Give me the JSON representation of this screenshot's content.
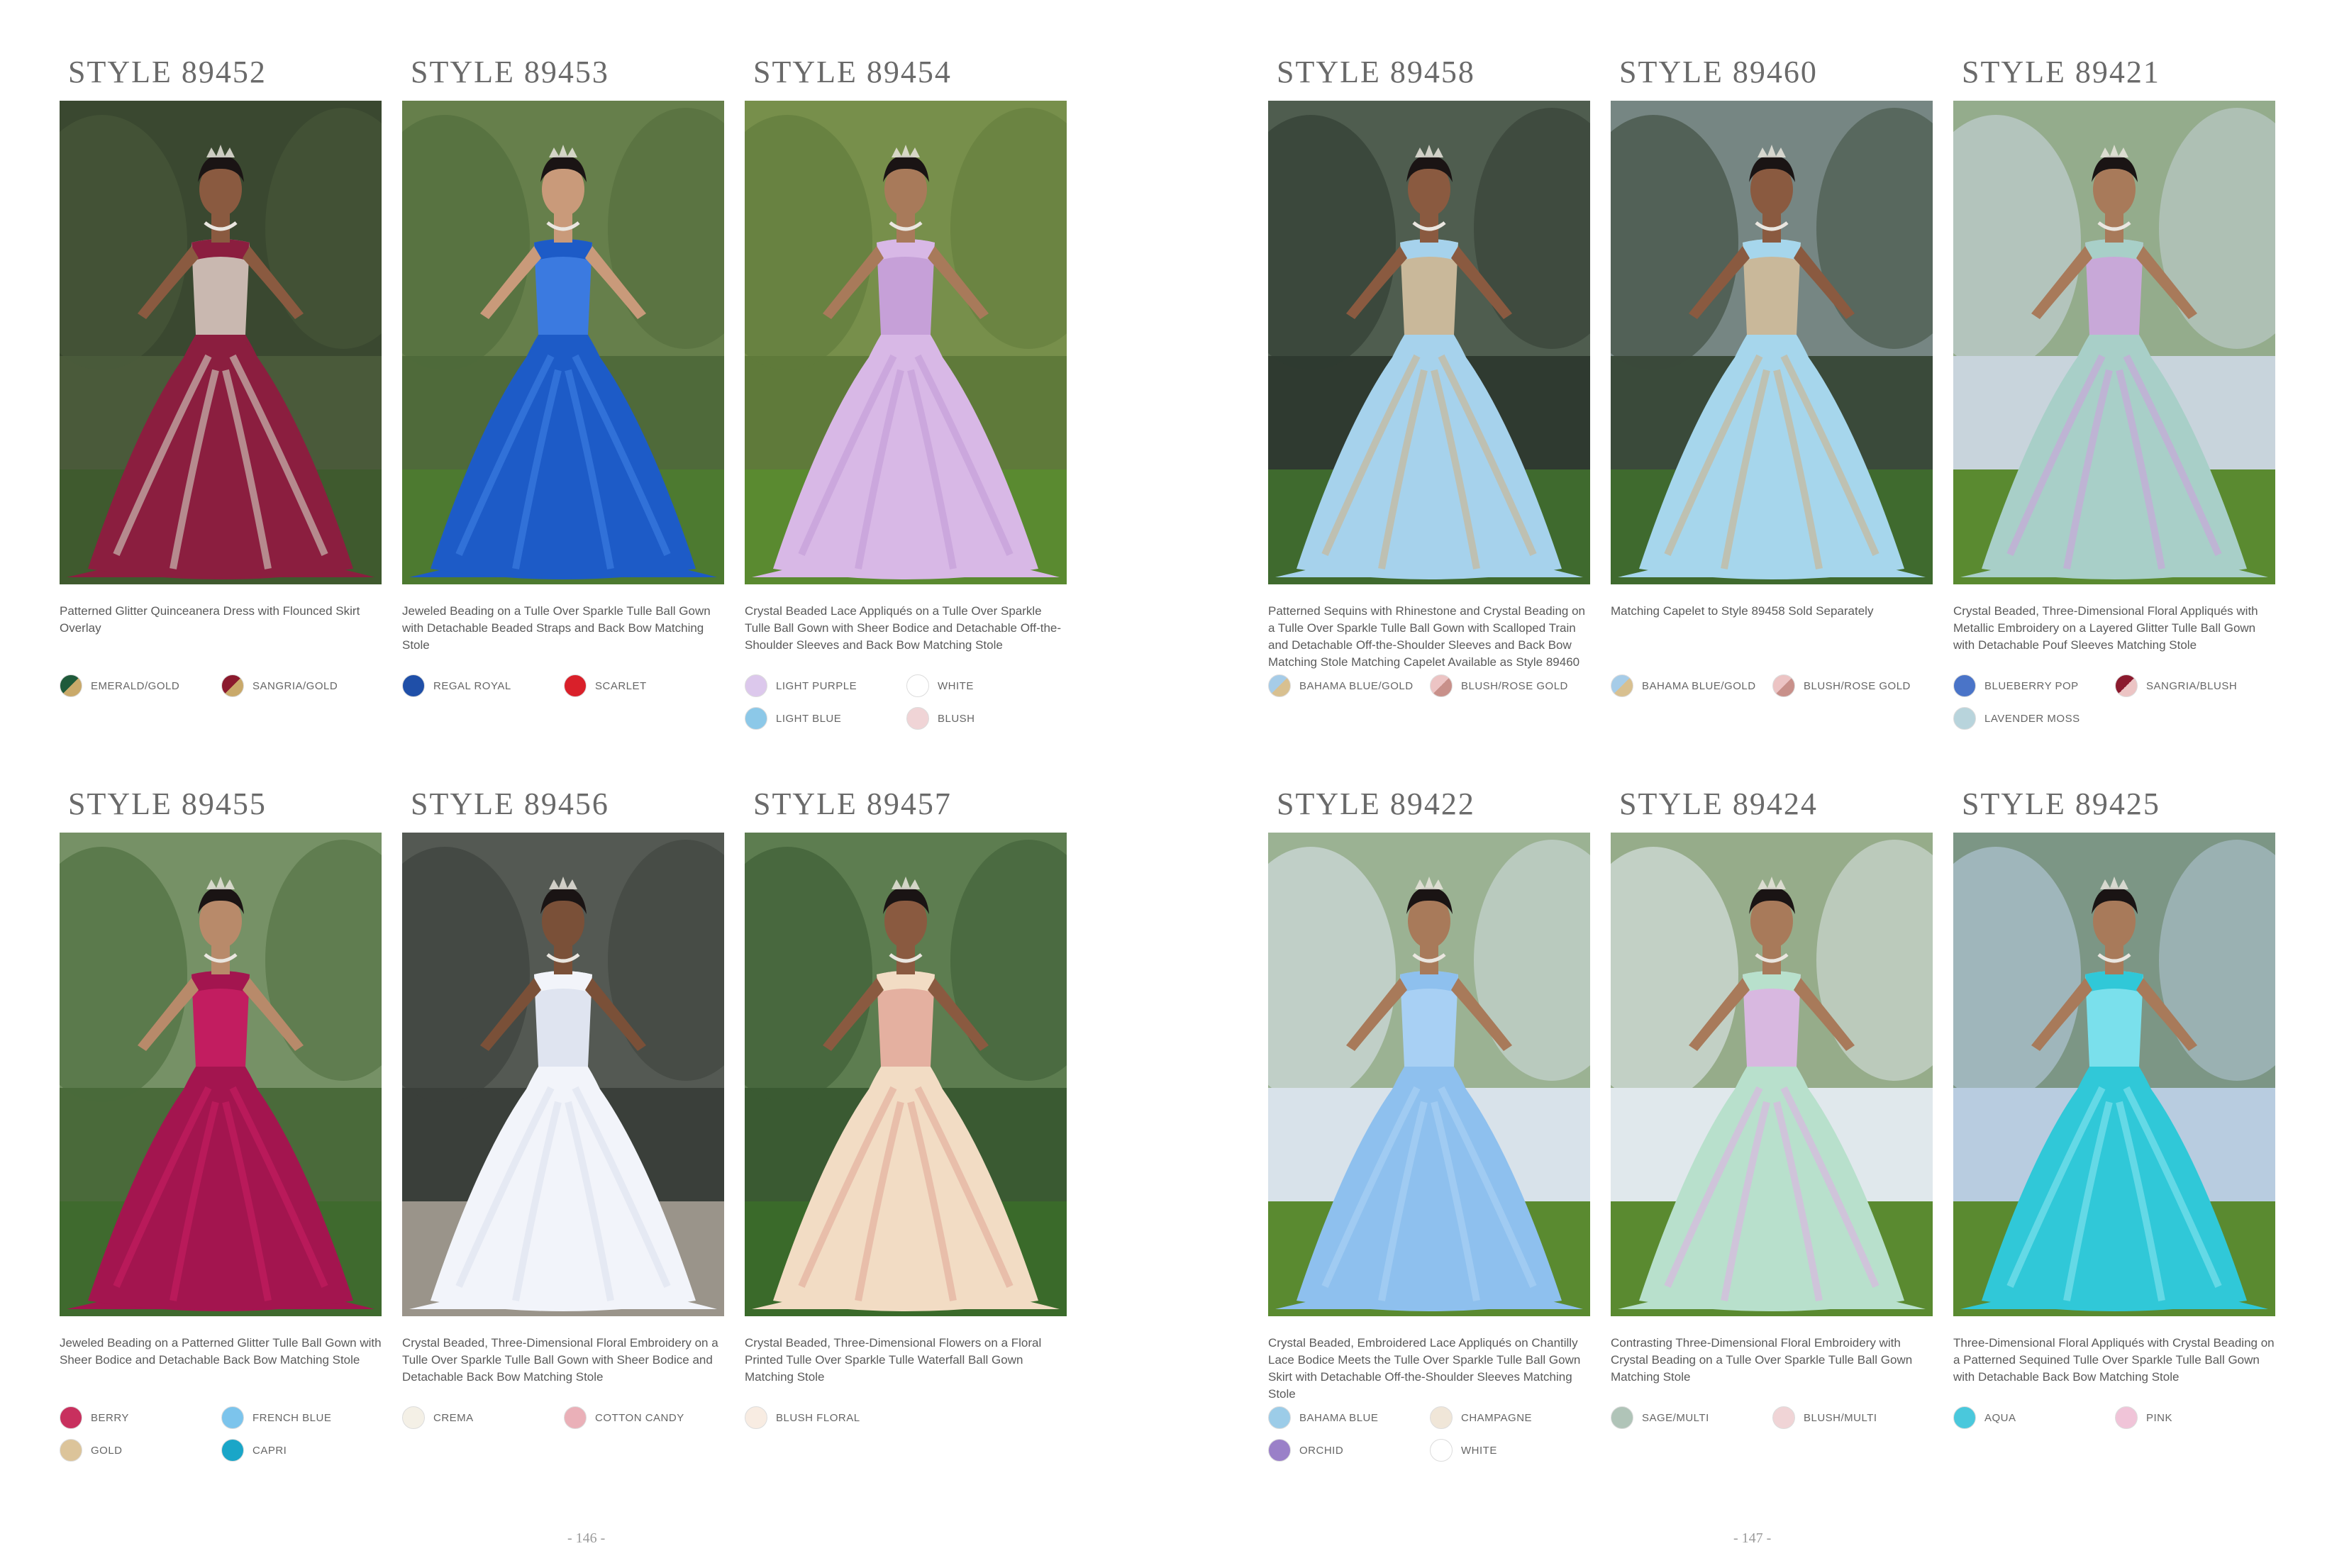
{
  "pages": [
    {
      "page_number": "- 146 -",
      "styles": [
        {
          "title": "STYLE 89452",
          "desc": "Patterned Glitter Quinceanera Dress with Flounced Skirt Overlay",
          "scene": {
            "bg": "#4a5a3a",
            "bg2": "#2e3a28",
            "ground": "#3f5a2e",
            "gown": "#8b1e3f",
            "gown2": "#c9b8b0",
            "skin": "#8a5a40",
            "hair": "#1a1414"
          },
          "colors": [
            {
              "name": "EMERALD/GOLD",
              "a": "#1f5a3a",
              "b": "#c9a96a"
            },
            {
              "name": "SANGRIA/GOLD",
              "a": "#8b1a2e",
              "b": "#c9a96a"
            }
          ]
        },
        {
          "title": "STYLE 89453",
          "desc": "Jeweled Beading on a Tulle Over Sparkle Tulle Ball Gown with Detachable Beaded Straps and Back Bow Matching Stole",
          "scene": {
            "bg": "#4f6a3a",
            "bg2": "#7a8f5a",
            "ground": "#4d7a30",
            "gown": "#1d5bc7",
            "gown2": "#3b7ae0",
            "skin": "#c99a7a",
            "hair": "#1a1414"
          },
          "colors": [
            {
              "name": "REGAL ROYAL",
              "a": "#1f4fa8",
              "b": "#1f4fa8"
            },
            {
              "name": "SCARLET",
              "a": "#d9202a",
              "b": "#d9202a"
            }
          ]
        },
        {
          "title": "STYLE 89454",
          "desc": "Crystal Beaded Lace Appliqués on a Tulle Over Sparkle Tulle Ball Gown with Sheer Bodice and Detachable Off-the-Shoulder Sleeves and Back Bow Matching Stole",
          "scene": {
            "bg": "#5f7a3a",
            "bg2": "#8aa05a",
            "ground": "#5a8a30",
            "gown": "#d8b8e6",
            "gown2": "#c6a0d8",
            "skin": "#a87a5a",
            "hair": "#1a1414"
          },
          "colors": [
            {
              "name": "LIGHT PURPLE",
              "a": "#dcc8ec",
              "b": "#dcc8ec"
            },
            {
              "name": "WHITE",
              "a": "#ffffff",
              "b": "#ffffff"
            },
            {
              "name": "LIGHT BLUE",
              "a": "#8cc8e8",
              "b": "#8cc8e8"
            },
            {
              "name": "BLUSH",
              "a": "#f0d4d6",
              "b": "#f0d4d6"
            }
          ]
        },
        {
          "title": "STYLE 89455",
          "desc": "Jeweled Beading on a Patterned Glitter Tulle Ball Gown with Sheer Bodice and Detachable Back Bow Matching Stole",
          "scene": {
            "bg": "#4a6a3a",
            "bg2": "#9ab08a",
            "ground": "#3f6a2e",
            "gown": "#a3154f",
            "gown2": "#c21d60",
            "skin": "#b88a6a",
            "hair": "#1a1414"
          },
          "colors": [
            {
              "name": "BERRY",
              "a": "#c8305e",
              "b": "#c8305e"
            },
            {
              "name": "FRENCH BLUE",
              "a": "#7cc4ec",
              "b": "#7cc4ec"
            },
            {
              "name": "GOLD",
              "a": "#dcc49a",
              "b": "#dcc49a"
            },
            {
              "name": "CAPRI",
              "a": "#1aa6c8",
              "b": "#1aa6c8"
            }
          ]
        },
        {
          "title": "STYLE 89456",
          "desc": "Crystal Beaded, Three-Dimensional Floral Embroidery on a Tulle Over Sparkle Tulle Ball Gown with Sheer Bodice and Detachable Back Bow Matching Stole",
          "scene": {
            "bg": "#3a3f3a",
            "bg2": "#6a6f68",
            "ground": "#9a948a",
            "gown": "#f2f4fa",
            "gown2": "#dfe4f0",
            "skin": "#7a5038",
            "hair": "#1a1414"
          },
          "colors": [
            {
              "name": "CREMA",
              "a": "#f4f0e6",
              "b": "#f4f0e6"
            },
            {
              "name": "COTTON CANDY",
              "a": "#eab0b8",
              "b": "#eab0b8"
            }
          ]
        },
        {
          "title": "STYLE 89457",
          "desc": "Crystal Beaded, Three-Dimensional Flowers on a Floral Printed Tulle Over Sparkle Tulle Waterfall Ball Gown Matching Stole",
          "scene": {
            "bg": "#3a5a32",
            "bg2": "#7a9a6a",
            "ground": "#3a6a2a",
            "gown": "#f2dcc4",
            "gown2": "#e4b0a0",
            "skin": "#8a5a40",
            "hair": "#1a1414"
          },
          "colors": [
            {
              "name": "BLUSH FLORAL",
              "a": "#f8ece2",
              "b": "#f8ece2"
            }
          ]
        }
      ]
    },
    {
      "page_number": "- 147 -",
      "styles": [
        {
          "title": "STYLE 89458",
          "desc": "Patterned Sequins with Rhinestone and Crystal Beading on a Tulle Over Sparkle Tulle Ball Gown with Scalloped Train and Detachable Off-the-Shoulder Sleeves and Back Bow Matching Stole Matching Capelet Available as Style 89460",
          "scene": {
            "bg": "#2f3a30",
            "bg2": "#6a7a6a",
            "ground": "#3f6a2e",
            "gown": "#a6d2ec",
            "gown2": "#c9b89a",
            "skin": "#8a5a40",
            "hair": "#1a1414"
          },
          "colors": [
            {
              "name": "BAHAMA BLUE/GOLD",
              "a": "#a6cce8",
              "b": "#d8c090"
            },
            {
              "name": "BLUSH/ROSE GOLD",
              "a": "#ecc4c4",
              "b": "#c8908a"
            }
          ]
        },
        {
          "title": "STYLE 89460",
          "desc": "Matching Capelet to Style 89458 Sold Separately",
          "scene": {
            "bg": "#3a4a3a",
            "bg2": "#a8b8c0",
            "ground": "#3f6a2e",
            "gown": "#a6d6ec",
            "gown2": "#c9b89a",
            "skin": "#8a5a40",
            "hair": "#1a1414"
          },
          "colors": [
            {
              "name": "BAHAMA BLUE/GOLD",
              "a": "#a6cce8",
              "b": "#d8c090"
            },
            {
              "name": "BLUSH/ROSE GOLD",
              "a": "#ecc4c4",
              "b": "#c8908a"
            }
          ]
        },
        {
          "title": "STYLE 89421",
          "desc": "Crystal Beaded, Three-Dimensional Floral Appliqués with Metallic Embroidery on a Layered Glitter Tulle Ball Gown with Detachable Pouf Sleeves Matching Stole",
          "scene": {
            "bg": "#c8d4dc",
            "bg2": "#6a8a4a",
            "ground": "#5a8a30",
            "gown": "#a8cfc8",
            "gown2": "#c8a8d8",
            "skin": "#a87a5a",
            "hair": "#1a1414"
          },
          "colors": [
            {
              "name": "BLUEBERRY POP",
              "a": "#4a74c8",
              "b": "#4a74c8"
            },
            {
              "name": "SANGRIA/BLUSH",
              "a": "#8b1a2e",
              "b": "#ecc4c4"
            },
            {
              "name": "LAVENDER MOSS",
              "a": "#b8d4dc",
              "b": "#b8d4dc"
            }
          ]
        },
        {
          "title": "STYLE 89422",
          "desc": "Crystal Beaded, Embroidered Lace Appliqués on Chantilly Lace Bodice Meets the Tulle Over Sparkle Tulle Ball Gown Skirt with Detachable Off-the-Shoulder Sleeves Matching Stole",
          "scene": {
            "bg": "#d8e2ea",
            "bg2": "#6a8a4a",
            "ground": "#5a8a30",
            "gown": "#8ec0ee",
            "gown2": "#a8d0f4",
            "skin": "#a87a5a",
            "hair": "#1a1414"
          },
          "colors": [
            {
              "name": "BAHAMA BLUE",
              "a": "#9ccce8",
              "b": "#9ccce8"
            },
            {
              "name": "CHAMPAGNE",
              "a": "#f0e6d8",
              "b": "#f0e6d8"
            },
            {
              "name": "ORCHID",
              "a": "#9a80c8",
              "b": "#9a80c8"
            },
            {
              "name": "WHITE",
              "a": "#ffffff",
              "b": "#ffffff"
            }
          ]
        },
        {
          "title": "STYLE 89424",
          "desc": "Contrasting Three-Dimensional Floral Embroidery with Crystal Beading on a Tulle Over Sparkle Tulle Ball Gown Matching Stole",
          "scene": {
            "bg": "#e0e8ec",
            "bg2": "#5a7a3a",
            "ground": "#5a8a30",
            "gown": "#b8e0cc",
            "gown2": "#d8b8e0",
            "skin": "#a87a5a",
            "hair": "#1a1414"
          },
          "colors": [
            {
              "name": "SAGE/MULTI",
              "a": "#b0c4b8",
              "b": "#b0c4b8"
            },
            {
              "name": "BLUSH/MULTI",
              "a": "#f0d4d6",
              "b": "#f0d4d6"
            }
          ]
        },
        {
          "title": "STYLE 89425",
          "desc": "Three-Dimensional Floral Appliqués with Crystal Beading on a Patterned Sequined Tulle Over Sparkle Tulle Ball Gown with Detachable Back Bow Matching Stole",
          "scene": {
            "bg": "#b8cce0",
            "bg2": "#4a6a3a",
            "ground": "#5a8a30",
            "gown": "#30c8d8",
            "gown2": "#7ae0ec",
            "skin": "#a87a5a",
            "hair": "#1a1414"
          },
          "colors": [
            {
              "name": "AQUA",
              "a": "#4ac8dc",
              "b": "#4ac8dc"
            },
            {
              "name": "PINK",
              "a": "#f0c4d8",
              "b": "#f0c4d8"
            }
          ]
        }
      ]
    }
  ]
}
